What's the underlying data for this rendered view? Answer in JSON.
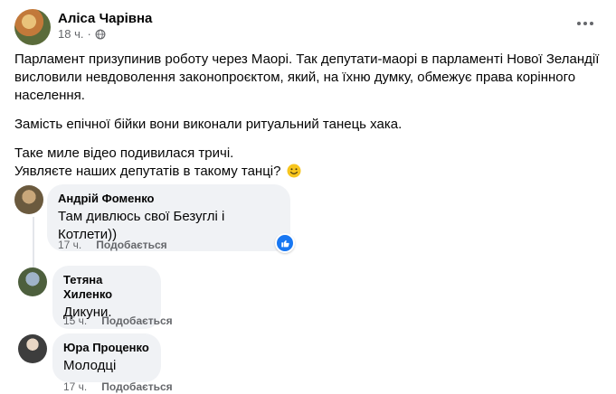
{
  "post": {
    "author": "Аліса Чарівна",
    "timestamp": "18 ч.",
    "paragraphs": [
      "Парламент призупинив роботу через Маорі. Так депутати-маорі в парламенті Нової Зеландії висловили невдоволення законопроєктом, який, на їхню думку, обмежує права корінного населення.",
      "Замість епічної бійки вони виконали ритуальний танець хака.",
      "Таке миле відео подивилася тричі.",
      "Уявляєте наших депутатів в такому танці?"
    ]
  },
  "comments": [
    {
      "name": "Андрій Фоменко",
      "text": "Там дивлюсь свої Безуглі і Котлети))",
      "time": "17 ч.",
      "like": "Подобається"
    },
    {
      "name": "Тетяна Хиленко",
      "text": "Дикуни.",
      "time": "15 ч.",
      "like": "Подобається"
    },
    {
      "name": "Юра Проценко",
      "text": "Молодці",
      "time": "17 ч.",
      "like": "Подобається"
    }
  ],
  "icons": {
    "privacy": "globe-icon",
    "more": "more-options-icon",
    "emoji": "smiley-emoji-icon",
    "reaction": "like-reaction-icon"
  },
  "colors": {
    "bubble": "#f0f2f5",
    "secondary_text": "#65676b",
    "like_blue": "#1877f2"
  }
}
